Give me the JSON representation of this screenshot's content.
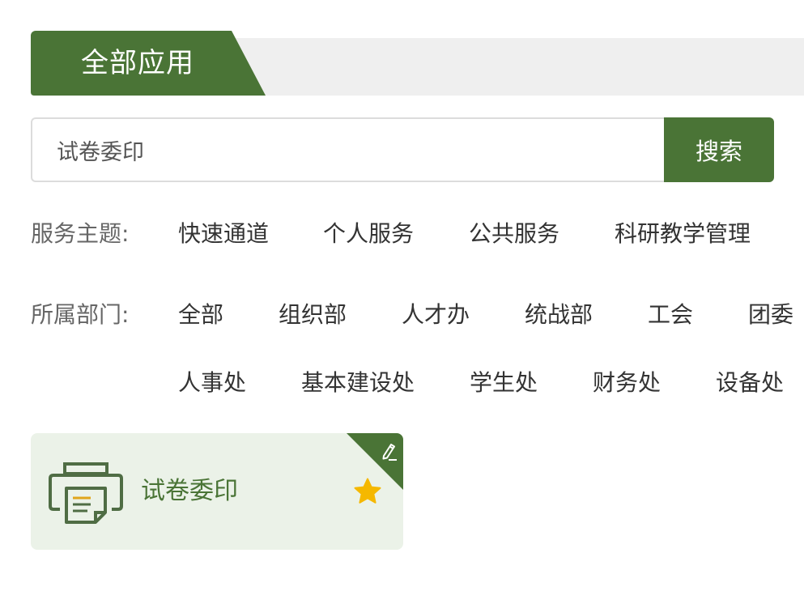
{
  "header": {
    "title": "全部应用"
  },
  "search": {
    "value": "试卷委印",
    "placeholder": "试卷委印",
    "button_label": "搜索"
  },
  "filters": {
    "service_topic": {
      "label": "服务主题:",
      "items": [
        "快速通道",
        "个人服务",
        "公共服务",
        "科研教学管理"
      ]
    },
    "department": {
      "label": "所属部门:",
      "row1": [
        "全部",
        "组织部",
        "人才办",
        "统战部",
        "工会",
        "团委"
      ],
      "row2": [
        "人事处",
        "基本建设处",
        "学生处",
        "财务处",
        "设备处"
      ]
    }
  },
  "apps": [
    {
      "name": "试卷委印",
      "icon": "printer-icon",
      "favorite": true
    }
  ],
  "colors": {
    "accent": "#4a7436",
    "card_bg": "#ebf2e8",
    "star": "#f5b800"
  }
}
